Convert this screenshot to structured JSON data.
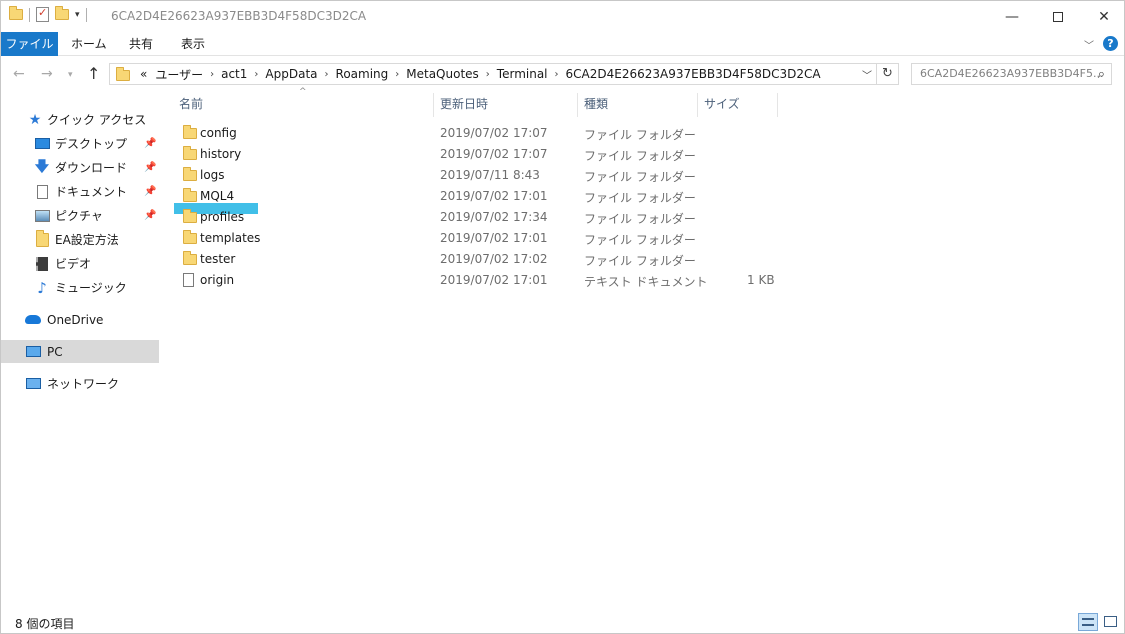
{
  "window": {
    "title": "6CA2D4E26623A937EBB3D4F58DC3D2CA"
  },
  "ribbon": {
    "tabs": [
      "ファイル",
      "ホーム",
      "共有",
      "表示"
    ]
  },
  "address": {
    "overflow": "«",
    "crumbs": [
      "ユーザー",
      "act1",
      "AppData",
      "Roaming",
      "MetaQuotes",
      "Terminal",
      "6CA2D4E26623A937EBB3D4F58DC3D2CA"
    ]
  },
  "search": {
    "placeholder": "6CA2D4E26623A937EBB3D4F5..."
  },
  "sidebar": {
    "quick_access": "クイック アクセス",
    "items": [
      {
        "label": "デスクトップ",
        "icon": "desktop-icon",
        "pinned": true
      },
      {
        "label": "ダウンロード",
        "icon": "download-icon",
        "pinned": true
      },
      {
        "label": "ドキュメント",
        "icon": "documents-icon",
        "pinned": true
      },
      {
        "label": "ピクチャ",
        "icon": "pictures-icon",
        "pinned": true
      },
      {
        "label": "EA設定方法",
        "icon": "folder-icon",
        "pinned": false
      },
      {
        "label": "ビデオ",
        "icon": "video-icon",
        "pinned": false
      },
      {
        "label": "ミュージック",
        "icon": "music-icon",
        "pinned": false
      }
    ],
    "onedrive": "OneDrive",
    "pc": "PC",
    "network": "ネットワーク"
  },
  "columns": {
    "name": "名前",
    "date": "更新日時",
    "type": "種類",
    "size": "サイズ"
  },
  "files": [
    {
      "name": "config",
      "date": "2019/07/02 17:07",
      "type": "ファイル フォルダー",
      "size": "",
      "icon": "folder-icon"
    },
    {
      "name": "history",
      "date": "2019/07/02 17:07",
      "type": "ファイル フォルダー",
      "size": "",
      "icon": "folder-icon"
    },
    {
      "name": "logs",
      "date": "2019/07/11 8:43",
      "type": "ファイル フォルダー",
      "size": "",
      "icon": "folder-icon"
    },
    {
      "name": "MQL4",
      "date": "2019/07/02 17:01",
      "type": "ファイル フォルダー",
      "size": "",
      "icon": "folder-icon"
    },
    {
      "name": "profiles",
      "date": "2019/07/02 17:34",
      "type": "ファイル フォルダー",
      "size": "",
      "icon": "folder-icon"
    },
    {
      "name": "templates",
      "date": "2019/07/02 17:01",
      "type": "ファイル フォルダー",
      "size": "",
      "icon": "folder-icon"
    },
    {
      "name": "tester",
      "date": "2019/07/02 17:02",
      "type": "ファイル フォルダー",
      "size": "",
      "icon": "folder-icon"
    },
    {
      "name": "origin",
      "date": "2019/07/02 17:01",
      "type": "テキスト ドキュメント",
      "size": "1 KB",
      "icon": "text-file-icon"
    }
  ],
  "status": {
    "item_count": "8 個の項目"
  },
  "colors": {
    "accent": "#1979ca",
    "highlight": "#41bfe8",
    "folder": "#f8d775",
    "selected_nav": "#d9d9d9"
  }
}
